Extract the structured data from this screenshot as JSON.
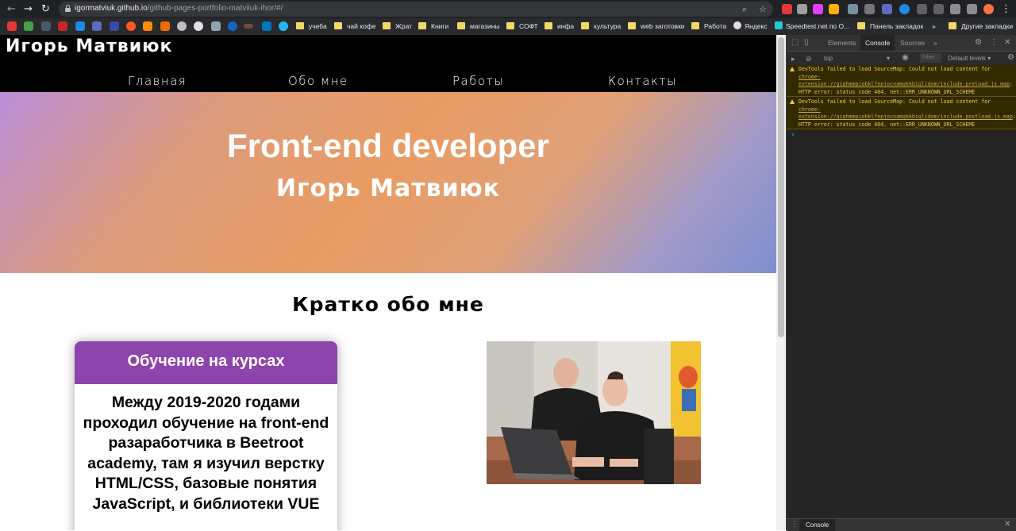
{
  "browser": {
    "url_host": "igormatviuk.github.io",
    "url_path": "/github-pages-portfolio-matviiuk-ihor/#/",
    "bookmarks": [
      {
        "label": "учеба"
      },
      {
        "label": "чай кофе"
      },
      {
        "label": "Жрат"
      },
      {
        "label": "Книги"
      },
      {
        "label": "магазины"
      },
      {
        "label": "СОФТ"
      },
      {
        "label": "инфа"
      },
      {
        "label": "культура"
      },
      {
        "label": "web заготовки"
      },
      {
        "label": "Работа"
      }
    ],
    "bookmark_yandex": "Яндекс",
    "bookmark_speedtest": "Speedtest.net по О...",
    "bookmark_panel": "Панель закладок",
    "bookmark_more": "»",
    "bookmark_other": "Другие закладки"
  },
  "site": {
    "brand": "Игорь Матвиюк",
    "nav": [
      {
        "label": "Главная"
      },
      {
        "label": "Обо мне"
      },
      {
        "label": "Работы"
      },
      {
        "label": "Контакты"
      }
    ],
    "hero_title": "Front-end developer",
    "hero_subtitle": "Игорь Матвиюк",
    "section_title": "Кратко обо мне",
    "card": {
      "heading": "Обучение на курсах",
      "text": "Между 2019-2020 годами проходил обучение на front-end разаработчика в Beetroot academy, там я изучил верстку HTML/CSS, базовые понятия JavaScript, и библиотеки VUE"
    }
  },
  "devtools": {
    "tabs": [
      {
        "label": "Elements"
      },
      {
        "label": "Console"
      },
      {
        "label": "Sources"
      }
    ],
    "more_tabs": "»",
    "context": "top",
    "filter_placeholder": "Filter",
    "levels": "Default levels ▾",
    "messages": [
      {
        "prefix": "DevTools failed to load SourceMap: Could not load content for ",
        "link": "chrome-extension://gighmmpiobklfepjocnamgkkbiglidom/include.preload.js.map",
        "suffix": ": HTTP error: status code 404, net::ERR_UNKNOWN_URL_SCHEME"
      },
      {
        "prefix": "DevTools failed to load SourceMap: Could not load content for ",
        "link": "chrome-extension://gighmmpiobklfepjocnamgkkbiglidom/include.postload.js.map",
        "suffix": ": HTTP error: status code 404, net::ERR_UNKNOWN_URL_SCHEME"
      }
    ],
    "prompt": "›",
    "drawer_tab": "Console"
  },
  "colors": {
    "card_header": "#8e44ad",
    "warning_text": "#f2c94c",
    "warning_bg": "#332b00"
  }
}
